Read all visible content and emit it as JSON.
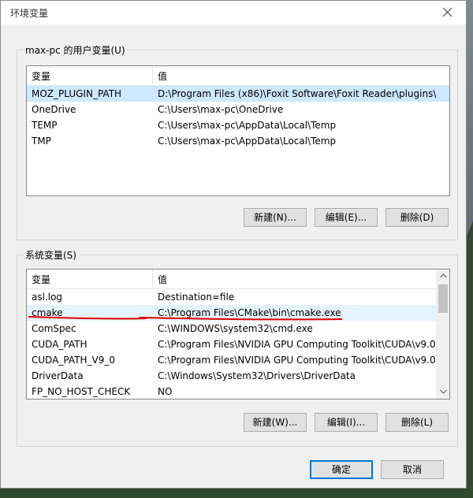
{
  "dialog": {
    "title": "环境变量"
  },
  "user_group": {
    "label": "max-pc 的用户变量(U)",
    "col_name": "变量",
    "col_value": "值",
    "rows": [
      {
        "name": "MOZ_PLUGIN_PATH",
        "value": "D:\\Program Files (x86)\\Foxit Software\\Foxit Reader\\plugins\\"
      },
      {
        "name": "OneDrive",
        "value": "C:\\Users\\max-pc\\OneDrive"
      },
      {
        "name": "TEMP",
        "value": "C:\\Users\\max-pc\\AppData\\Local\\Temp"
      },
      {
        "name": "TMP",
        "value": "C:\\Users\\max-pc\\AppData\\Local\\Temp"
      }
    ],
    "buttons": {
      "new": "新建(N)...",
      "edit": "编辑(E)...",
      "delete": "删除(D)"
    }
  },
  "system_group": {
    "label": "系统变量(S)",
    "col_name": "变量",
    "col_value": "值",
    "rows": [
      {
        "name": "asl.log",
        "value": "Destination=file"
      },
      {
        "name": "cmake",
        "value": "C:\\Program Files\\CMake\\bin\\cmake.exe"
      },
      {
        "name": "ComSpec",
        "value": "C:\\WINDOWS\\system32\\cmd.exe"
      },
      {
        "name": "CUDA_PATH",
        "value": "C:\\Program Files\\NVIDIA GPU Computing Toolkit\\CUDA\\v9.0"
      },
      {
        "name": "CUDA_PATH_V9_0",
        "value": "C:\\Program Files\\NVIDIA GPU Computing Toolkit\\CUDA\\v9.0"
      },
      {
        "name": "DriverData",
        "value": "C:\\Windows\\System32\\Drivers\\DriverData"
      },
      {
        "name": "FP_NO_HOST_CHECK",
        "value": "NO"
      }
    ],
    "buttons": {
      "new": "新建(W)...",
      "edit": "编辑(I)...",
      "delete": "删除(L)"
    }
  },
  "footer": {
    "ok": "确定",
    "cancel": "取消"
  },
  "colors": {
    "selection": "#cde8ff",
    "annotation": "#e00000",
    "accent": "#0078d7"
  }
}
